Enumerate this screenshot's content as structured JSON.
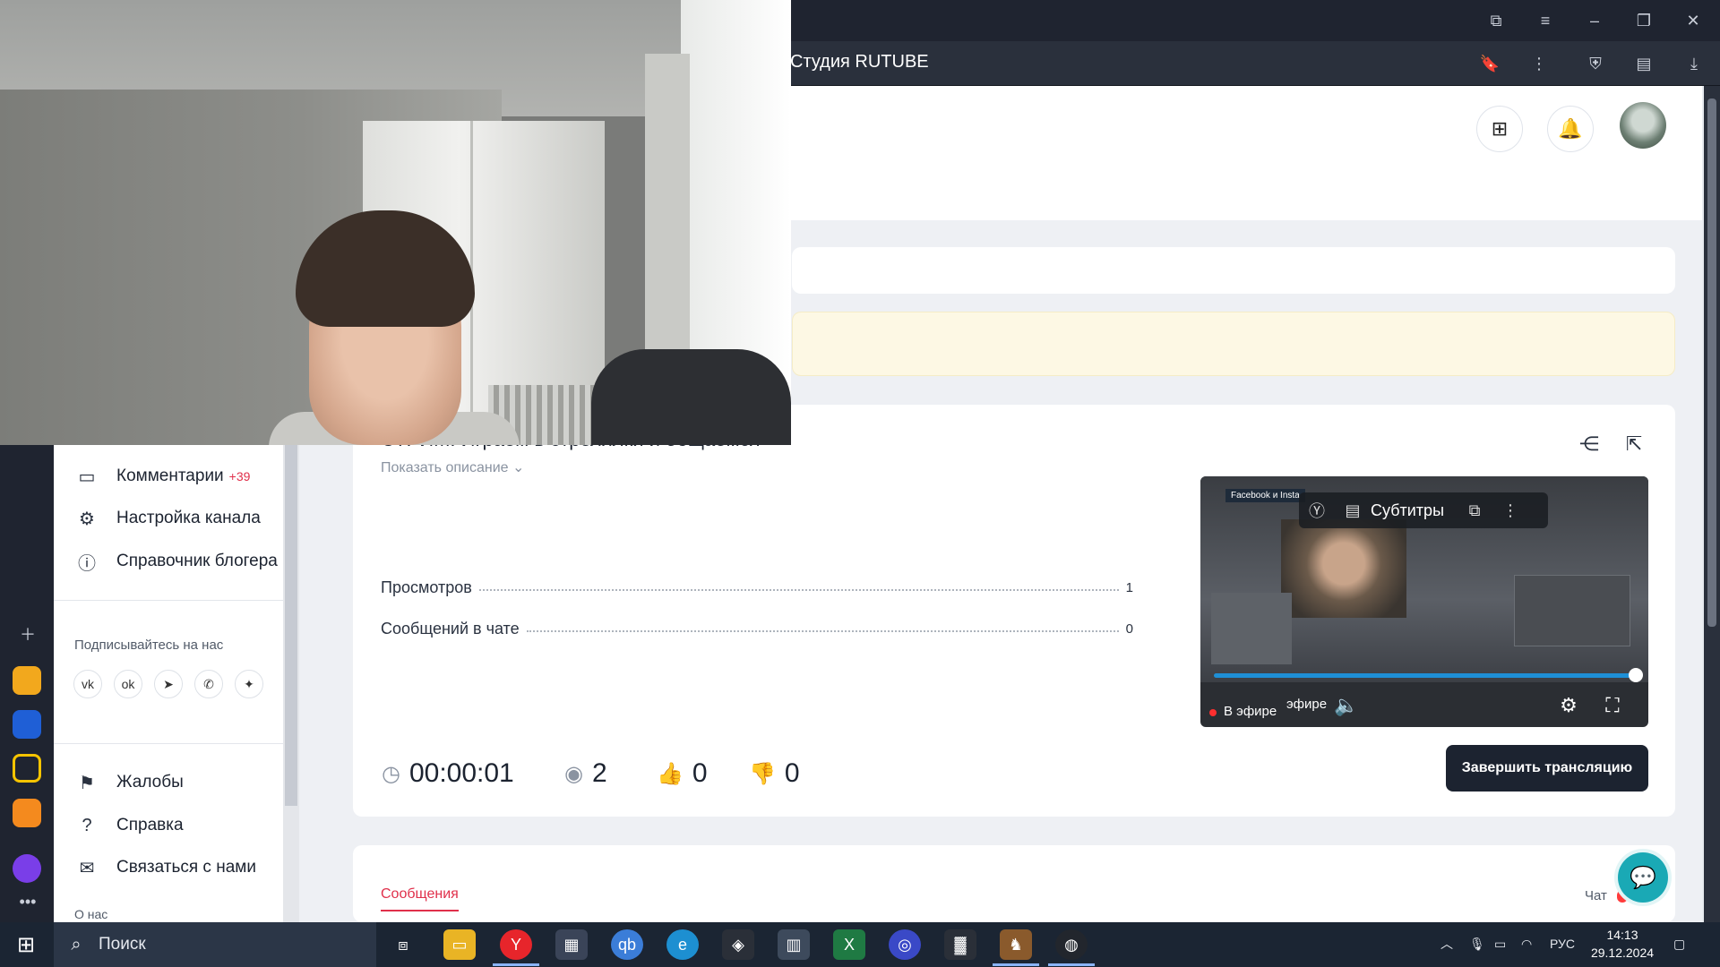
{
  "browser": {
    "tab_title": "Студия RUTUBE"
  },
  "sidebar": {
    "items": [
      {
        "label": "Комментарии",
        "badge": "+39",
        "icon": "comment-icon"
      },
      {
        "label": "Настройка канала",
        "icon": "gear-icon"
      },
      {
        "label": "Справочник блогера",
        "icon": "info-icon"
      },
      {
        "label": "Жалобы",
        "icon": "flag-icon"
      },
      {
        "label": "Справка",
        "icon": "question-icon"
      },
      {
        "label": "Связаться с нами",
        "icon": "mail-icon"
      }
    ],
    "follow_label": "Подписывайтесь на нас",
    "socials": [
      "vk-icon",
      "ok-icon",
      "telegram-icon",
      "viber-icon",
      "plus-icon"
    ],
    "about_label": "О нас"
  },
  "stream": {
    "title": "СТРИМ. Играем в стрелялки и общаемся",
    "show_description": "Показать описание",
    "stats": [
      {
        "label": "Просмотров",
        "value": "1"
      },
      {
        "label": "Сообщений в чате",
        "value": "0"
      }
    ],
    "duration": "00:00:01",
    "viewers": "2",
    "likes": "0",
    "dislikes": "0",
    "end_button": "Завершить трансляцию"
  },
  "player": {
    "subtitles_label": "Субтитры",
    "live_label": "В эфире",
    "live_label_partial": "эфире",
    "overlay_tag": "Facebook и Insta",
    "progress": 1.0
  },
  "tabs": {
    "messages": "Сообщения",
    "chat": "Чат"
  },
  "taskbar": {
    "search_placeholder": "Поиск",
    "language": "РУС",
    "time": "14:13",
    "date": "29.12.2024"
  },
  "colors": {
    "accent_red": "#e0304b",
    "dark_button": "#1c2330",
    "progress_blue": "#1e8fd6",
    "help_teal": "#1aa9b5"
  }
}
